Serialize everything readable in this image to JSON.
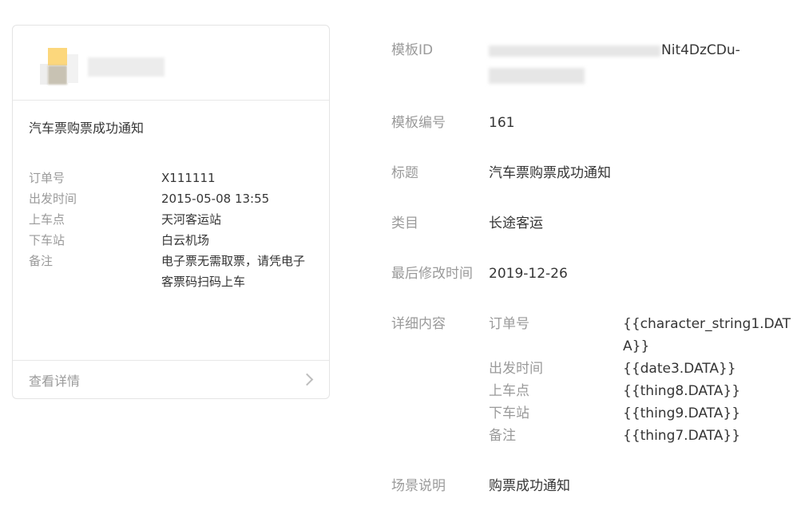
{
  "card": {
    "title": "汽车票购票成功通知",
    "rows": [
      {
        "label": "订单号",
        "value": "X111111"
      },
      {
        "label": "出发时间",
        "value": "2015-05-08 13:55"
      },
      {
        "label": "上车点",
        "value": "天河客运站"
      },
      {
        "label": "下车站",
        "value": "白云机场"
      },
      {
        "label": "备注",
        "value": "电子票无需取票，请凭电子客票码扫码上车"
      }
    ],
    "footer_label": "查看详情"
  },
  "detail": {
    "template_id": {
      "label": "模板ID",
      "value": "Nit4DzCDu-"
    },
    "template_no": {
      "label": "模板编号",
      "value": "161"
    },
    "title": {
      "label": "标题",
      "value": "汽车票购票成功通知"
    },
    "category": {
      "label": "类目",
      "value": "长途客运"
    },
    "modified": {
      "label": "最后修改时间",
      "value": "2019-12-26"
    },
    "content": {
      "label": "详细内容",
      "rows": [
        {
          "key": "订单号",
          "value": "{{character_string1.DATA}}"
        },
        {
          "key": "出发时间",
          "value": "{{date3.DATA}}"
        },
        {
          "key": "上车点",
          "value": "{{thing8.DATA}}"
        },
        {
          "key": "下车站",
          "value": "{{thing9.DATA}}"
        },
        {
          "key": "备注",
          "value": "{{thing7.DATA}}"
        }
      ]
    },
    "scene": {
      "label": "场景说明",
      "value": "购票成功通知"
    }
  }
}
